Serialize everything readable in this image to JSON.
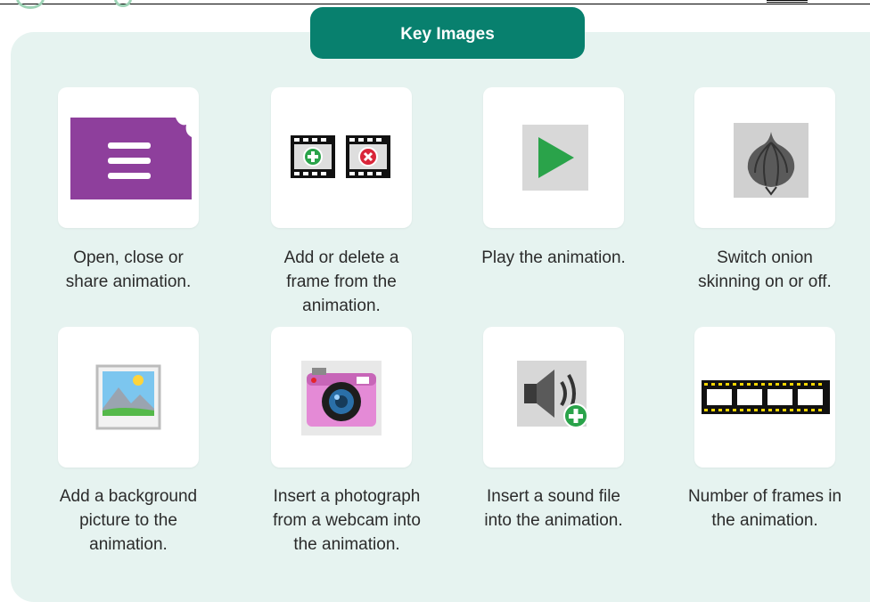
{
  "header": {
    "title": "Key Images"
  },
  "colors": {
    "accent": "#08806e",
    "panel": "#e6f3f0",
    "menu_purple": "#8e3f9c",
    "play_green": "#2aa34a"
  },
  "items": [
    {
      "icon": "menu-folder-icon",
      "caption": [
        "Open, close or",
        "share animation."
      ]
    },
    {
      "icon": "add-delete-frame-icon",
      "caption": [
        "Add or delete a",
        "frame from the",
        "animation."
      ]
    },
    {
      "icon": "play-icon",
      "caption": [
        "Play the animation."
      ]
    },
    {
      "icon": "onion-icon",
      "caption": [
        "Switch onion",
        "skinning on or off."
      ]
    },
    {
      "icon": "background-picture-icon",
      "caption": [
        "Add a background",
        "picture to the",
        "animation."
      ]
    },
    {
      "icon": "webcam-camera-icon",
      "caption": [
        "Insert a photograph",
        "from a webcam into",
        "the animation."
      ]
    },
    {
      "icon": "add-sound-icon",
      "caption": [
        "Insert a sound file",
        "into the animation."
      ]
    },
    {
      "icon": "film-frames-icon",
      "caption": [
        "Number of frames in",
        "the animation."
      ]
    }
  ]
}
